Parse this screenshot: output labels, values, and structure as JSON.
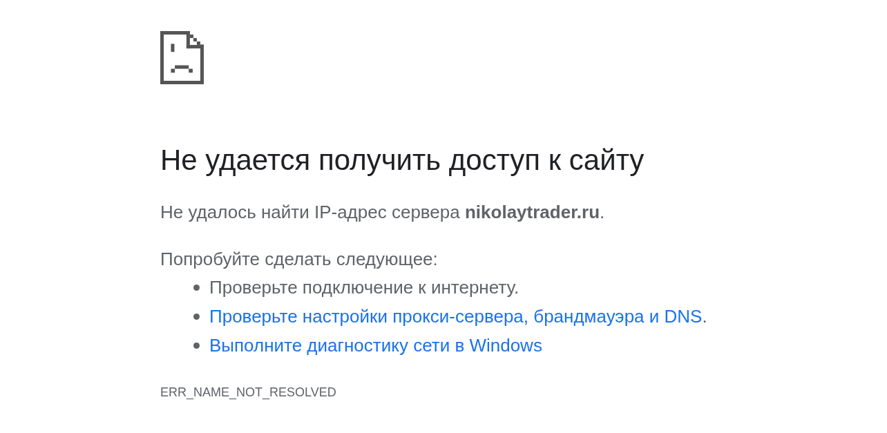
{
  "title": "Не удается получить доступ к сайту",
  "message": "Не удалось найти IP-адрес сервера **nikolaytrader.ru**.",
  "suggestions_heading": "Попробуйте сделать следующее:",
  "suggestions": [
    {
      "kind": "text",
      "text": "Проверьте подключение к интернету."
    },
    {
      "kind": "link",
      "link": "Проверьте настройки прокси-сервера, брандмауэра и DNS",
      "after": "."
    },
    {
      "kind": "link",
      "link": "Выполните диагностику сети в Windows"
    }
  ],
  "error_code": "ERR_NAME_NOT_RESOLVED"
}
